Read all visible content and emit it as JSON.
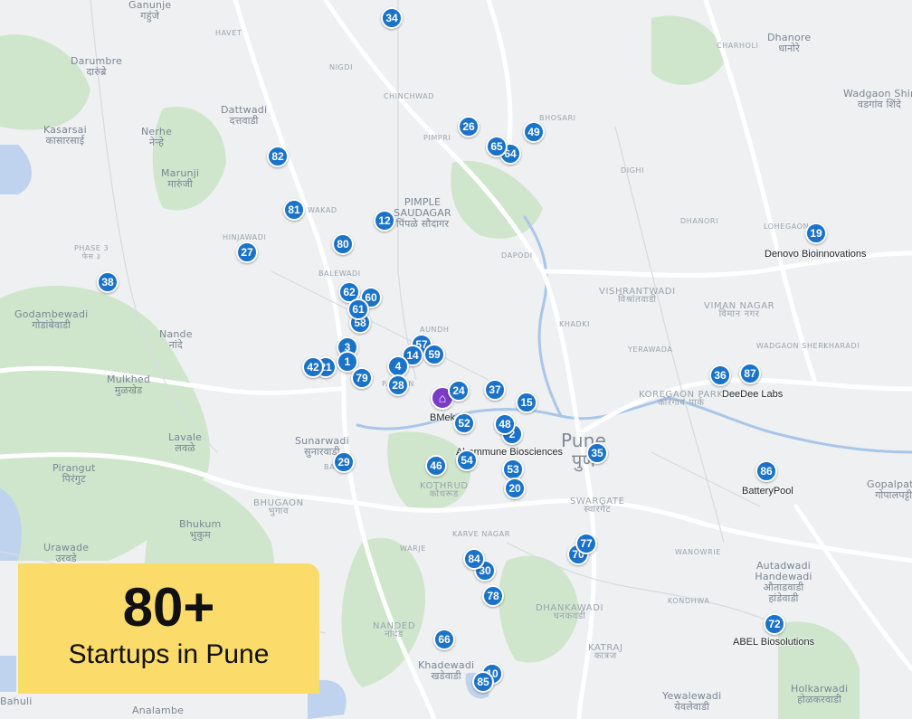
{
  "theme": {
    "pin_color": "#1b73c9",
    "home_color": "#7a3cc6",
    "badge_color": "#fbdb6a",
    "water_color": "#bfd3ef",
    "green_color": "#c9e3c6"
  },
  "badge": {
    "count": "80+",
    "subtitle": "Startups in Pune"
  },
  "home_marker": {
    "icon": "home-icon",
    "label": "BMek"
  },
  "company_labels": [
    "Denovo Bioinnovations",
    "DeeDee Labs",
    "Ahammune Biosciences",
    "BatteryPool",
    "ABEL Biosolutions"
  ],
  "places": [
    {
      "en": "Ganunje",
      "mr": "गहुंजे"
    },
    {
      "en": "Darumbre",
      "mr": "दारुंब्रे"
    },
    {
      "en": "Kasarsai",
      "mr": "कासारसाई"
    },
    {
      "en": "Nerhe",
      "mr": "नेऱ्हे"
    },
    {
      "en": "Dattwadi",
      "mr": "दत्तवाडी"
    },
    {
      "en": "Marunji",
      "mr": "मारुंजी"
    },
    {
      "en": "Dhanore",
      "mr": "धानोरे"
    },
    {
      "en": "Wadgaon Shinde",
      "mr": "वडगांव शिंदे"
    },
    {
      "en": "PIMPLE SAUDAGAR",
      "mr": "पिंपळे सौदागर"
    },
    {
      "en": "PHASE 3",
      "mr": "फेस ३"
    },
    {
      "en": "Godambewadi",
      "mr": "गोडांबेवाडी"
    },
    {
      "en": "Nande",
      "mr": "नांदे"
    },
    {
      "en": "VISHRANTWADI",
      "mr": "विश्रांतवाडी"
    },
    {
      "en": "VIMAN NAGAR",
      "mr": "विमान नगर"
    },
    {
      "en": "Mulkhed",
      "mr": "मुळखेड"
    },
    {
      "en": "KOREGAON PARK",
      "mr": "कोरेगाव पार्क"
    },
    {
      "en": "Lavale",
      "mr": "लवळे"
    },
    {
      "en": "Sunarwadi",
      "mr": "सुनारवाडी"
    },
    {
      "en": "Pune",
      "mr": "पुणे"
    },
    {
      "en": "Pirangut",
      "mr": "पिरंगुट"
    },
    {
      "en": "KOTHRUD",
      "mr": "कोथरूड"
    },
    {
      "en": "BHUGAON",
      "mr": "भुगाव"
    },
    {
      "en": "Bhukum",
      "mr": "भुकुम"
    },
    {
      "en": "SWARGATE",
      "mr": "स्वारगेट"
    },
    {
      "en": "Gopalpatti",
      "mr": "गोपालपट्टी"
    },
    {
      "en": "Urawade",
      "mr": "उरवडे"
    },
    {
      "en": "Autadwadi Handewadi",
      "mr": "औताडवाडी हांडेवाडी"
    },
    {
      "en": "DHANKAWADI",
      "mr": "धनकवडी"
    },
    {
      "en": "NANDED",
      "mr": "नांदेड"
    },
    {
      "en": "KATRAJ",
      "mr": "कात्रज"
    },
    {
      "en": "Khadewadi",
      "mr": "खडेवाडी"
    },
    {
      "en": "Yewalewadi",
      "mr": "येवलेवाडी"
    },
    {
      "en": "Holkarwadi",
      "mr": "होळकरवाडी"
    },
    {
      "en": "Analambe",
      "mr": ""
    },
    {
      "en": "Bahuli",
      "mr": ""
    }
  ],
  "small_places": [
    "HAVET",
    "NIGDI",
    "CHINCHWAD",
    "BHOSARI",
    "PIMPRI",
    "CHARHOLI",
    "DIGHI",
    "DHANORI",
    "LOHEGAON",
    "WAKAD",
    "HINJAWADI",
    "BALEWADI",
    "DAPODI",
    "KHADKI",
    "YERAWADA",
    "WADGAON SHERI",
    "KHARADI",
    "AUNDH",
    "PASHAN",
    "BANER",
    "KARVE NAGAR",
    "WARJE",
    "WANOWRIE",
    "KONDHWA"
  ],
  "pins": [
    "34",
    "26",
    "49",
    "65",
    "64",
    "82",
    "81",
    "12",
    "80",
    "27",
    "38",
    "19",
    "62",
    "60",
    "61",
    "58",
    "3",
    "1",
    "57",
    "14",
    "59",
    "42",
    "21",
    "79",
    "4",
    "28",
    "24",
    "37",
    "15",
    "36",
    "87",
    "52",
    "48",
    "2",
    "35",
    "29",
    "46",
    "54",
    "53",
    "86",
    "20",
    "77",
    "70",
    "84",
    "30",
    "78",
    "72",
    "66",
    "85",
    "10"
  ]
}
